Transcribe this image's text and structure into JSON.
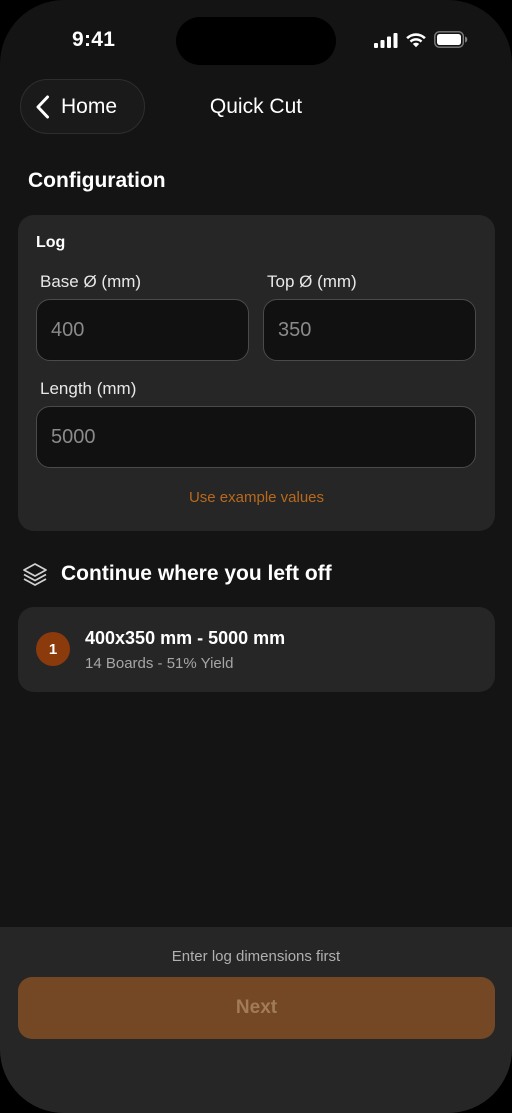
{
  "status": {
    "time": "9:41"
  },
  "nav": {
    "back_label": "Home",
    "title": "Quick Cut"
  },
  "configuration": {
    "section_title": "Configuration",
    "card_title": "Log",
    "base": {
      "label": "Base Ø (mm)",
      "placeholder": "400"
    },
    "top": {
      "label": "Top Ø (mm)",
      "placeholder": "350"
    },
    "length": {
      "label": "Length (mm)",
      "placeholder": "5000"
    },
    "example_link": "Use example values"
  },
  "continue": {
    "title": "Continue where you left off",
    "items": [
      {
        "badge": "1",
        "title": "400x350 mm - 5000 mm",
        "subtitle": "14 Boards - 51% Yield"
      }
    ]
  },
  "footer": {
    "hint": "Enter log dimensions first",
    "next_label": "Next"
  },
  "colors": {
    "accent": "#b8691d",
    "button_disabled": "#744824",
    "badge": "#8b3a0c"
  },
  "icons": {
    "back": "chevron-left-icon",
    "continue": "layers-icon"
  }
}
